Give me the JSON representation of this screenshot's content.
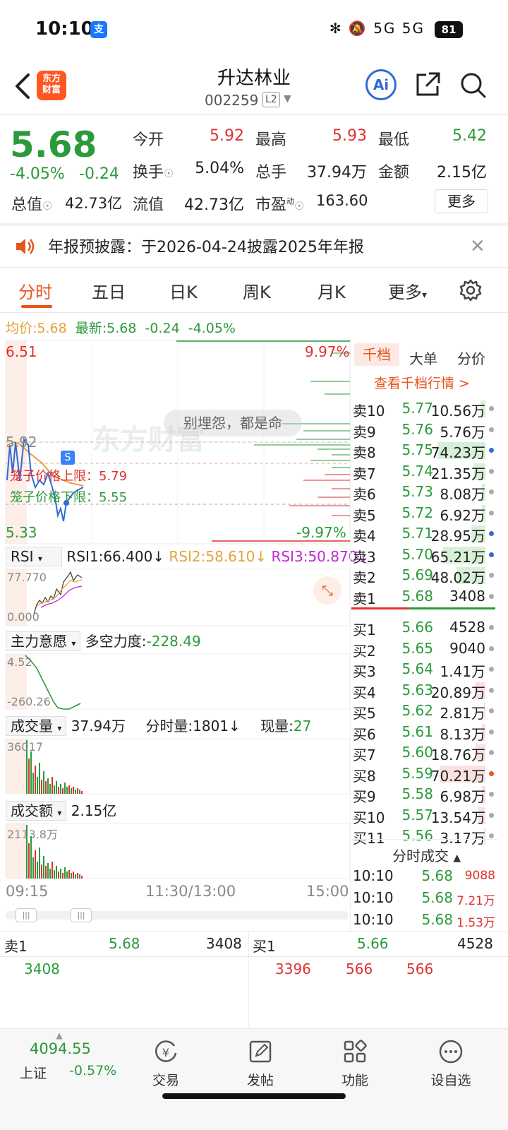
{
  "status_bar": {
    "time": "10:10",
    "alipay_icon": "支",
    "signal_text": "✻ 🔕 5G 5G",
    "battery": "81"
  },
  "header": {
    "brand_logo": "东方\n财富",
    "stock_name": "升达林业",
    "stock_code": "002259",
    "level_badge": "L2",
    "ai_label": "Ai"
  },
  "quote": {
    "price": "5.68",
    "change_pct": "-4.05%",
    "change_abs": "-0.24",
    "open_label": "今开",
    "open": "5.92",
    "high_label": "最高",
    "high": "5.93",
    "low_label": "最低",
    "low": "5.42",
    "turnover_label": "换手",
    "turnover": "5.04%",
    "volume_label": "总手",
    "volume": "37.94万",
    "amount_label": "金额",
    "amount": "2.15亿",
    "mktcap_label": "总值",
    "mktcap": "42.73亿",
    "float_label": "流值",
    "float_cap": "42.73亿",
    "pe_label": "市盈",
    "pe_sup": "动",
    "pe": "163.60",
    "more_btn": "更多"
  },
  "notice": {
    "text": "年报预披露：于2026-04-24披露2025年年报"
  },
  "tabs": [
    "分时",
    "五日",
    "日K",
    "周K",
    "月K",
    "更多"
  ],
  "avg_line": {
    "avg_label": "均价:",
    "avg": "5.68",
    "latest_label": "最新:",
    "latest": "5.68",
    "chg": "-0.24",
    "pct": "-4.05%"
  },
  "intraday": {
    "y_top": "6.51",
    "y_bottom": "5.33",
    "y_mid": "5.92",
    "pct_top": "9.97%",
    "pct_bottom": "-9.97%",
    "watermark": "东方财富",
    "bubble": "别埋怨，都是命",
    "s_marker": "S",
    "cage_upper": "笼子价格上限：5.79",
    "cage_lower": "笼子价格下限：5.55",
    "time_start": "09:15",
    "time_mid": "11:30/13:00",
    "time_end": "15:00"
  },
  "rsi": {
    "name": "RSI",
    "rsi1": "RSI1:66.400↓",
    "rsi2": "RSI2:58.610↓",
    "rsi3": "RSI3:50.870↓",
    "y_top": "77.770",
    "y_bottom": "0.000"
  },
  "main_force": {
    "name": "主力意愿",
    "label": "多空力度:",
    "value": "-228.49",
    "y_top": "4.52",
    "y_bottom": "-260.26"
  },
  "volume_panel": {
    "name": "成交量",
    "total": "37.94万",
    "minute_label": "分时量:",
    "minute": "1801↓",
    "current_label": "现量:",
    "current": "27",
    "y_top": "36017"
  },
  "amount_panel": {
    "name": "成交额",
    "total": "2.15亿",
    "y_top": "2113.8万"
  },
  "order_book": {
    "tabs": [
      "千档",
      "大单",
      "分价"
    ],
    "link": "查看千档行情 >",
    "asks": [
      {
        "label": "卖10",
        "price": "5.77",
        "vol": "10.56万",
        "bar": 0.1,
        "dot": "#aaa"
      },
      {
        "label": "卖9",
        "price": "5.76",
        "vol": "5.76万",
        "bar": 0.0,
        "dot": "#aaa"
      },
      {
        "label": "卖8",
        "price": "5.75",
        "vol": "74.23万",
        "bar": 1.0,
        "dot": "#2f6bd8"
      },
      {
        "label": "卖7",
        "price": "5.74",
        "vol": "21.35万",
        "bar": 0.25,
        "dot": "#aaa"
      },
      {
        "label": "卖6",
        "price": "5.73",
        "vol": "8.08万",
        "bar": 0.08,
        "dot": "#aaa"
      },
      {
        "label": "卖5",
        "price": "5.72",
        "vol": "6.92万",
        "bar": 0.07,
        "dot": "#aaa"
      },
      {
        "label": "卖4",
        "price": "5.71",
        "vol": "28.95万",
        "bar": 0.3,
        "dot": "#2f6bd8"
      },
      {
        "label": "卖3",
        "price": "5.70",
        "vol": "65.21万",
        "bar": 0.88,
        "dot": "#2f6bd8"
      },
      {
        "label": "卖2",
        "price": "5.69",
        "vol": "48.02万",
        "bar": 0.6,
        "dot": "#aaa"
      },
      {
        "label": "卖1",
        "price": "5.68",
        "vol": "3408",
        "bar": 0.0,
        "dot": "#aaa"
      }
    ],
    "bids": [
      {
        "label": "买1",
        "price": "5.66",
        "vol": "4528",
        "bar": 0.0,
        "dot": "#aaa"
      },
      {
        "label": "买2",
        "price": "5.65",
        "vol": "9040",
        "bar": 0.0,
        "dot": "#aaa"
      },
      {
        "label": "买3",
        "price": "5.64",
        "vol": "1.41万",
        "bar": 0.0,
        "dot": "#aaa"
      },
      {
        "label": "买4",
        "price": "5.63",
        "vol": "20.89万",
        "bar": 0.22,
        "dot": "#aaa"
      },
      {
        "label": "买5",
        "price": "5.62",
        "vol": "2.81万",
        "bar": 0.03,
        "dot": "#aaa"
      },
      {
        "label": "买6",
        "price": "5.61",
        "vol": "8.13万",
        "bar": 0.08,
        "dot": "#aaa"
      },
      {
        "label": "买7",
        "price": "5.60",
        "vol": "18.76万",
        "bar": 0.2,
        "dot": "#aaa"
      },
      {
        "label": "买8",
        "price": "5.59",
        "vol": "70.21万",
        "bar": 0.95,
        "dot": "#e8541e"
      },
      {
        "label": "买9",
        "price": "5.58",
        "vol": "6.98万",
        "bar": 0.07,
        "dot": "#aaa"
      },
      {
        "label": "买10",
        "price": "5.57",
        "vol": "13.54万",
        "bar": 0.14,
        "dot": "#aaa"
      },
      {
        "label": "买11",
        "price": "5.56",
        "vol": "3.17万",
        "bar": 0.03,
        "dot": "#aaa"
      }
    ]
  },
  "time_sales": {
    "title": "分时成交",
    "rows": [
      {
        "time": "10:10",
        "price": "5.68",
        "vol": "9088"
      },
      {
        "time": "10:10",
        "price": "5.68",
        "vol": "7.21万"
      },
      {
        "time": "10:10",
        "price": "5.68",
        "vol": "1.53万"
      }
    ]
  },
  "bottom_book": {
    "ask_label": "卖1",
    "ask_price": "5.68",
    "ask_vol": "3408",
    "ask_detail": "3408",
    "bid_label": "买1",
    "bid_price": "5.66",
    "bid_vol": "4528",
    "bid_details": [
      "3396",
      "566",
      "566"
    ]
  },
  "nav": {
    "index_value": "4094.55",
    "index_name": "上证",
    "index_chg": "-0.57%",
    "items": [
      "交易",
      "发帖",
      "功能",
      "设自选"
    ]
  },
  "colors": {
    "up": "#e03131",
    "down": "#2b9a3b",
    "accent": "#e8541e",
    "avg": "#e6a23c",
    "price_line": "#2f6bd8"
  }
}
